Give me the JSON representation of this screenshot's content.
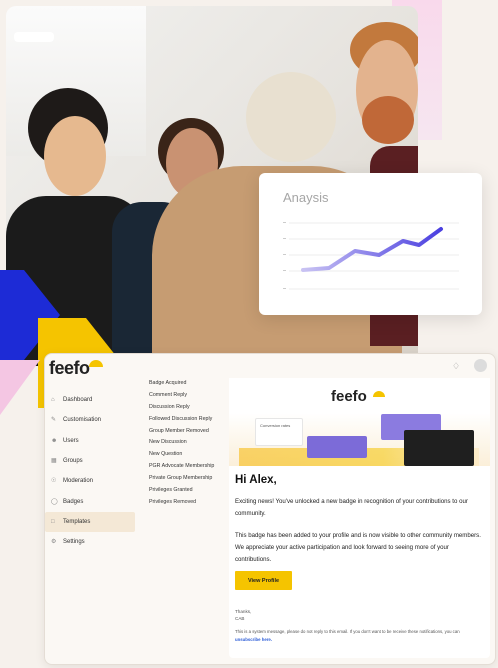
{
  "hero": {
    "analysis_card": {
      "title": "Anaysis"
    }
  },
  "app": {
    "logo": "feefo",
    "nav": {
      "items": [
        {
          "label": "Dashboard",
          "icon": "home-icon"
        },
        {
          "label": "Customisation",
          "icon": "brush-icon"
        },
        {
          "label": "Users",
          "icon": "users-icon"
        },
        {
          "label": "Groups",
          "icon": "groups-icon"
        },
        {
          "label": "Moderation",
          "icon": "shield-icon"
        },
        {
          "label": "Badges",
          "icon": "badge-icon"
        },
        {
          "label": "Templates",
          "icon": "template-icon",
          "active": true
        },
        {
          "label": "Settings",
          "icon": "gear-icon"
        }
      ]
    },
    "events": [
      "Badge Acquired",
      "Comment Reply",
      "Discussion Reply",
      "Followed Discussion Reply",
      "Group Member Removed",
      "New Discussion",
      "New Question",
      "PGR Advocate Membership",
      "Private Group Membership",
      "Privileges Granted",
      "Privileges Removed"
    ],
    "email": {
      "logo": "feefo",
      "illustration_label": "Conversion rates",
      "greeting": "Hi Alex,",
      "paragraph1": "Exciting news! You've unlocked a new badge in recognition of your contributions to our community.",
      "paragraph2": "This badge has been added to your profile and is now visible to other community members. We appreciate your active participation and look forward to seeing more of your contributions.",
      "cta": "View Profile",
      "signoff_line1": "Thanks,",
      "signoff_line2": "CAB",
      "footer_text": "This is a system message, please do not reply to this email. If you don't want to be receive these notifications, you can",
      "footer_link": "unsubscribe here."
    }
  },
  "colors": {
    "accent_yellow": "#f5c400",
    "accent_blue": "#1d2bd6",
    "accent_purple": "#7c6bd8",
    "chart_line": "#4a3fe0",
    "active_nav": "#f4e8d6"
  }
}
